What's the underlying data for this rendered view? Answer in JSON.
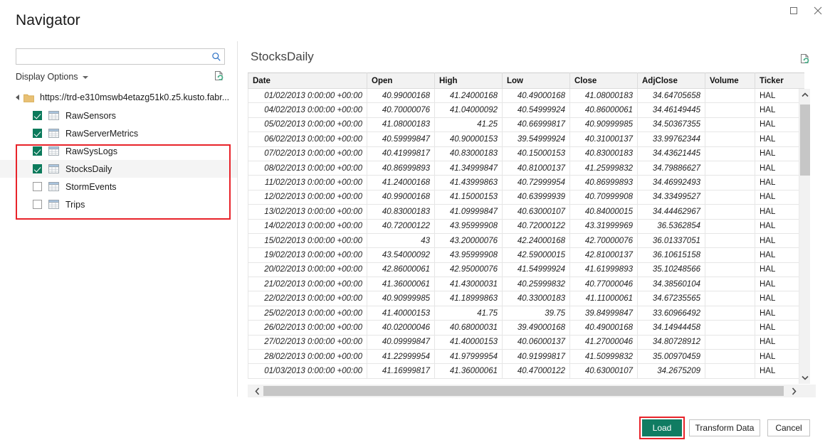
{
  "window": {
    "title": "Navigator",
    "controls": [
      {
        "name": "maximize",
        "label": ""
      },
      {
        "name": "close",
        "label": ""
      }
    ]
  },
  "search": {
    "value": "",
    "placeholder": "",
    "icon": "search-icon"
  },
  "display_options": {
    "label": "Display Options",
    "refresh_icon": "refresh-icon"
  },
  "tree": {
    "root": {
      "label": "https://trd-e310mswb4etazg51k0.z5.kusto.fabr...",
      "expanded": true,
      "icon": "folder-icon"
    },
    "items": [
      {
        "label": "RawSensors",
        "checked": true,
        "selected": false,
        "icon": "table-icon"
      },
      {
        "label": "RawServerMetrics",
        "checked": true,
        "selected": false,
        "icon": "table-icon"
      },
      {
        "label": "RawSysLogs",
        "checked": true,
        "selected": false,
        "icon": "table-icon"
      },
      {
        "label": "StocksDaily",
        "checked": true,
        "selected": true,
        "icon": "table-icon"
      },
      {
        "label": "StormEvents",
        "checked": false,
        "selected": false,
        "icon": "table-icon"
      },
      {
        "label": "Trips",
        "checked": false,
        "selected": false,
        "icon": "table-icon"
      }
    ]
  },
  "preview": {
    "title": "StocksDaily",
    "refresh_icon": "refresh-icon",
    "columns": [
      "Date",
      "Open",
      "High",
      "Low",
      "Close",
      "AdjClose",
      "Volume",
      "Ticker"
    ],
    "rows": [
      [
        "01/02/2013 0:00:00 +00:00",
        "40.99000168",
        "41.24000168",
        "40.49000168",
        "41.08000183",
        "34.64705658",
        "",
        "HAL"
      ],
      [
        "04/02/2013 0:00:00 +00:00",
        "40.70000076",
        "41.04000092",
        "40.54999924",
        "40.86000061",
        "34.46149445",
        "",
        "HAL"
      ],
      [
        "05/02/2013 0:00:00 +00:00",
        "41.08000183",
        "41.25",
        "40.66999817",
        "40.90999985",
        "34.50367355",
        "",
        "HAL"
      ],
      [
        "06/02/2013 0:00:00 +00:00",
        "40.59999847",
        "40.90000153",
        "39.54999924",
        "40.31000137",
        "33.99762344",
        "",
        "HAL"
      ],
      [
        "07/02/2013 0:00:00 +00:00",
        "40.41999817",
        "40.83000183",
        "40.15000153",
        "40.83000183",
        "34.43621445",
        "",
        "HAL"
      ],
      [
        "08/02/2013 0:00:00 +00:00",
        "40.86999893",
        "41.34999847",
        "40.81000137",
        "41.25999832",
        "34.79886627",
        "",
        "HAL"
      ],
      [
        "11/02/2013 0:00:00 +00:00",
        "41.24000168",
        "41.43999863",
        "40.72999954",
        "40.86999893",
        "34.46992493",
        "",
        "HAL"
      ],
      [
        "12/02/2013 0:00:00 +00:00",
        "40.99000168",
        "41.15000153",
        "40.63999939",
        "40.70999908",
        "34.33499527",
        "",
        "HAL"
      ],
      [
        "13/02/2013 0:00:00 +00:00",
        "40.83000183",
        "41.09999847",
        "40.63000107",
        "40.84000015",
        "34.44462967",
        "",
        "HAL"
      ],
      [
        "14/02/2013 0:00:00 +00:00",
        "40.72000122",
        "43.95999908",
        "40.72000122",
        "43.31999969",
        "36.5362854",
        "",
        "HAL"
      ],
      [
        "15/02/2013 0:00:00 +00:00",
        "43",
        "43.20000076",
        "42.24000168",
        "42.70000076",
        "36.01337051",
        "",
        "HAL"
      ],
      [
        "19/02/2013 0:00:00 +00:00",
        "43.54000092",
        "43.95999908",
        "42.59000015",
        "42.81000137",
        "36.10615158",
        "",
        "HAL"
      ],
      [
        "20/02/2013 0:00:00 +00:00",
        "42.86000061",
        "42.95000076",
        "41.54999924",
        "41.61999893",
        "35.10248566",
        "",
        "HAL"
      ],
      [
        "21/02/2013 0:00:00 +00:00",
        "41.36000061",
        "41.43000031",
        "40.25999832",
        "40.77000046",
        "34.38560104",
        "",
        "HAL"
      ],
      [
        "22/02/2013 0:00:00 +00:00",
        "40.90999985",
        "41.18999863",
        "40.33000183",
        "41.11000061",
        "34.67235565",
        "",
        "HAL"
      ],
      [
        "25/02/2013 0:00:00 +00:00",
        "41.40000153",
        "41.75",
        "39.75",
        "39.84999847",
        "33.60966492",
        "",
        "HAL"
      ],
      [
        "26/02/2013 0:00:00 +00:00",
        "40.02000046",
        "40.68000031",
        "39.49000168",
        "40.49000168",
        "34.14944458",
        "",
        "HAL"
      ],
      [
        "27/02/2013 0:00:00 +00:00",
        "40.09999847",
        "41.40000153",
        "40.06000137",
        "41.27000046",
        "34.80728912",
        "",
        "HAL"
      ],
      [
        "28/02/2013 0:00:00 +00:00",
        "41.22999954",
        "41.97999954",
        "40.91999817",
        "41.50999832",
        "35.00970459",
        "",
        "HAL"
      ],
      [
        "01/03/2013 0:00:00 +00:00",
        "41.16999817",
        "41.36000061",
        "40.47000122",
        "40.63000107",
        "34.2675209",
        "",
        "HAL"
      ]
    ]
  },
  "footer": {
    "load_label": "Load",
    "transform_label": "Transform Data",
    "cancel_label": "Cancel"
  },
  "colors": {
    "accent_green": "#107c62",
    "highlight_red": "#e8232a",
    "search_blue": "#2a6fc4"
  }
}
